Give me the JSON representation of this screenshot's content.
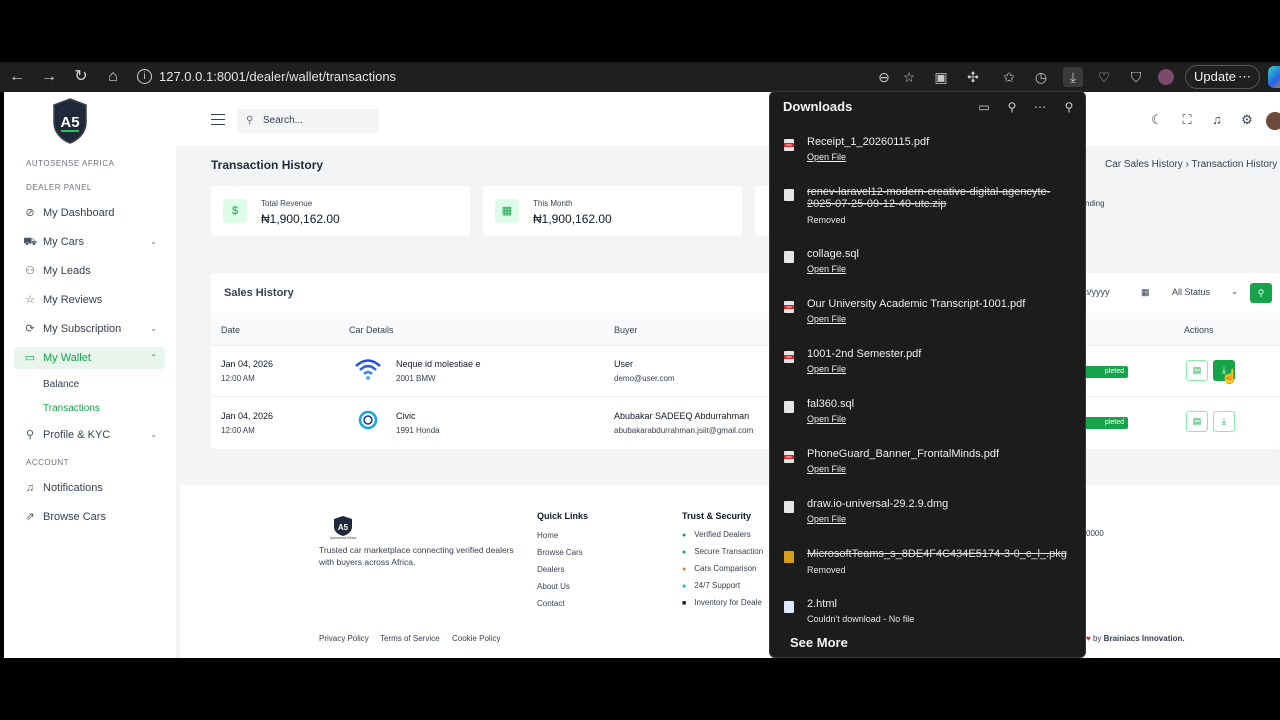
{
  "browser": {
    "url": "127.0.0.1:8001/dealer/wallet/transactions",
    "update_label": "Update",
    "update_dots": "⋯"
  },
  "sidebar": {
    "brand_caption": "AUTOSENSE AFRICA",
    "section_dealer": "DEALER PANEL",
    "section_account": "ACCOUNT",
    "items": [
      {
        "label": "My Dashboard",
        "icon": "dashboard-icon"
      },
      {
        "label": "My Cars",
        "icon": "car-icon"
      },
      {
        "label": "My Leads",
        "icon": "users-icon"
      },
      {
        "label": "My Reviews",
        "icon": "star-icon"
      },
      {
        "label": "My Subscription",
        "icon": "refresh-icon"
      },
      {
        "label": "My Wallet",
        "icon": "wallet-icon"
      },
      {
        "label": "Profile & KYC",
        "icon": "user-icon"
      },
      {
        "label": "Notifications",
        "icon": "bell-icon"
      },
      {
        "label": "Browse Cars",
        "icon": "external-link-icon"
      }
    ],
    "wallet_sub": [
      "Balance",
      "Transactions"
    ]
  },
  "topbar": {
    "search_placeholder": "Search..."
  },
  "main": {
    "page_title": "Transaction History",
    "breadcrumb": "Car Sales History  ›  Transaction History",
    "stats": [
      {
        "label": "Total Revenue",
        "value": "₦1,900,162.00"
      },
      {
        "label": "This Month",
        "value": "₦1,900,162.00"
      },
      {
        "label": "nding",
        "value": ""
      }
    ],
    "sales_title": "Sales History",
    "date_placeholder": "n/yyyy",
    "status_filter": "All Status",
    "columns": [
      "Date",
      "Car Details",
      "Buyer",
      "Actions"
    ],
    "rows": [
      {
        "date": "Jan 04, 2026",
        "time": "12:00 AM",
        "car": "Neque id molestiae e",
        "car_sub": "2001 BMW",
        "buyer": "User",
        "email": "demo@user.com",
        "status": "pleted"
      },
      {
        "date": "Jan 04, 2026",
        "time": "12:00 AM",
        "car": "Civic",
        "car_sub": "1991 Honda",
        "buyer": "Abubakar SADEEQ Abdurrahman",
        "email": "abubakarabdurrahman.jsiit@gmail.com",
        "status": "pleted"
      }
    ]
  },
  "footer": {
    "brand_caption": "Autosense Africa",
    "tagline": "Trusted car marketplace connecting verified dealers with buyers across Africa.",
    "quick_links_title": "Quick Links",
    "quick_links": [
      "Home",
      "Browse Cars",
      "Dealers",
      "About Us",
      "Contact"
    ],
    "trust_title": "Trust & Security",
    "trust_links": [
      "Verified Dealers",
      "Secure Transaction",
      "Cars Comparison",
      "24/7 Support",
      "Inventory for Deale"
    ],
    "contact_fragment": "0000",
    "legal": [
      "Privacy Policy",
      "Terms of Service",
      "Cookie Policy"
    ],
    "credit_prefix": "by",
    "credit": "Brainiacs Innovation."
  },
  "downloads": {
    "title": "Downloads",
    "items": [
      {
        "name": "Receipt_1_20260115.pdf",
        "action": "Open File",
        "type": "pdf"
      },
      {
        "name": "renev-laravel12-modern-creative-digital-agencyte-2025-07-25-09-12-40-utc.zip",
        "status": "Removed",
        "type": "zip"
      },
      {
        "name": "collage.sql",
        "action": "Open File",
        "type": "file"
      },
      {
        "name": "Our University Academic Transcript-1001.pdf",
        "action": "Open File",
        "type": "pdf"
      },
      {
        "name": "1001-2nd Semester.pdf",
        "action": "Open File",
        "type": "pdf"
      },
      {
        "name": "fal360.sql",
        "action": "Open File",
        "type": "file"
      },
      {
        "name": "PhoneGuard_Banner_FrontalMinds.pdf",
        "action": "Open File",
        "type": "pdf"
      },
      {
        "name": "draw.io-universal-29.2.9.dmg",
        "action": "Open File",
        "type": "file"
      },
      {
        "name": "MicrosoftTeams_s_8DE4F4C434E5174-3-0_c_l_.pkg",
        "status": "Removed",
        "type": "pkg"
      },
      {
        "name": "2.html",
        "status": "Couldn't download - No file",
        "type": "html"
      }
    ],
    "see_more": "See More"
  }
}
